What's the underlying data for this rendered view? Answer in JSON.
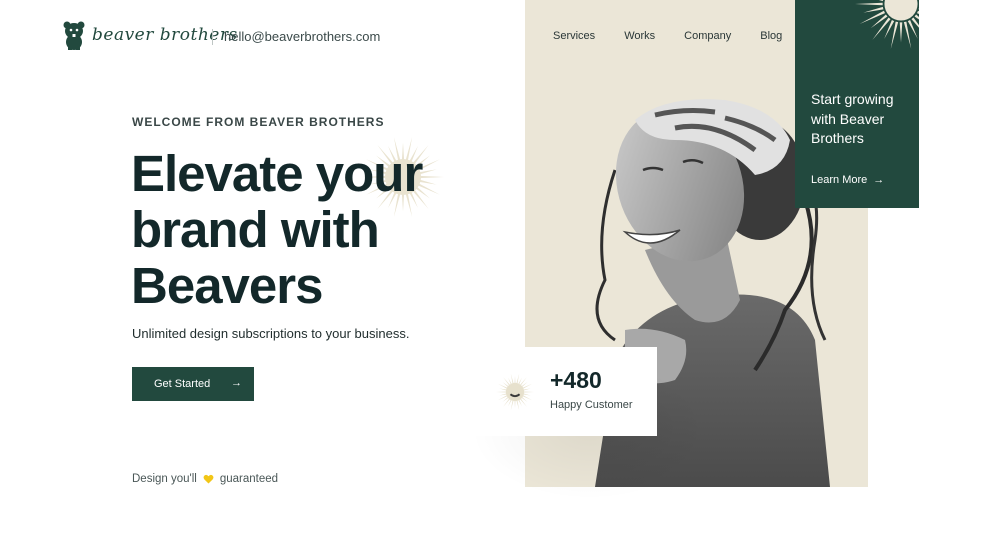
{
  "brand": {
    "name": "beaver brothers",
    "email": "hello@beaverbrothers.com"
  },
  "nav": [
    {
      "label": "Services"
    },
    {
      "label": "Works"
    },
    {
      "label": "Company"
    },
    {
      "label": "Blog"
    }
  ],
  "hero": {
    "eyebrow": "WELCOME FROM BEAVER BROTHERS",
    "headline_lines": [
      "Elevate your",
      "brand with",
      "Beavers"
    ],
    "subtext": "Unlimited design subscriptions to your business.",
    "cta_label": "Get Started",
    "guarantee_before": "Design you'll",
    "guarantee_after": "guaranteed"
  },
  "promo_card": {
    "title": "Start growing with Beaver Brothers",
    "link_label": "Learn More"
  },
  "stats": {
    "value": "+480",
    "label": "Happy Customer"
  },
  "colors": {
    "brand_green": "#22493e",
    "panel_beige": "#ebe6d7",
    "sun_beige": "#e7e1cd",
    "heart_yellow": "#f2c617",
    "headline": "#13282a"
  },
  "icons": [
    "beaver-logo-icon",
    "arrow-right-icon",
    "heart-icon",
    "sunburst-icon"
  ]
}
